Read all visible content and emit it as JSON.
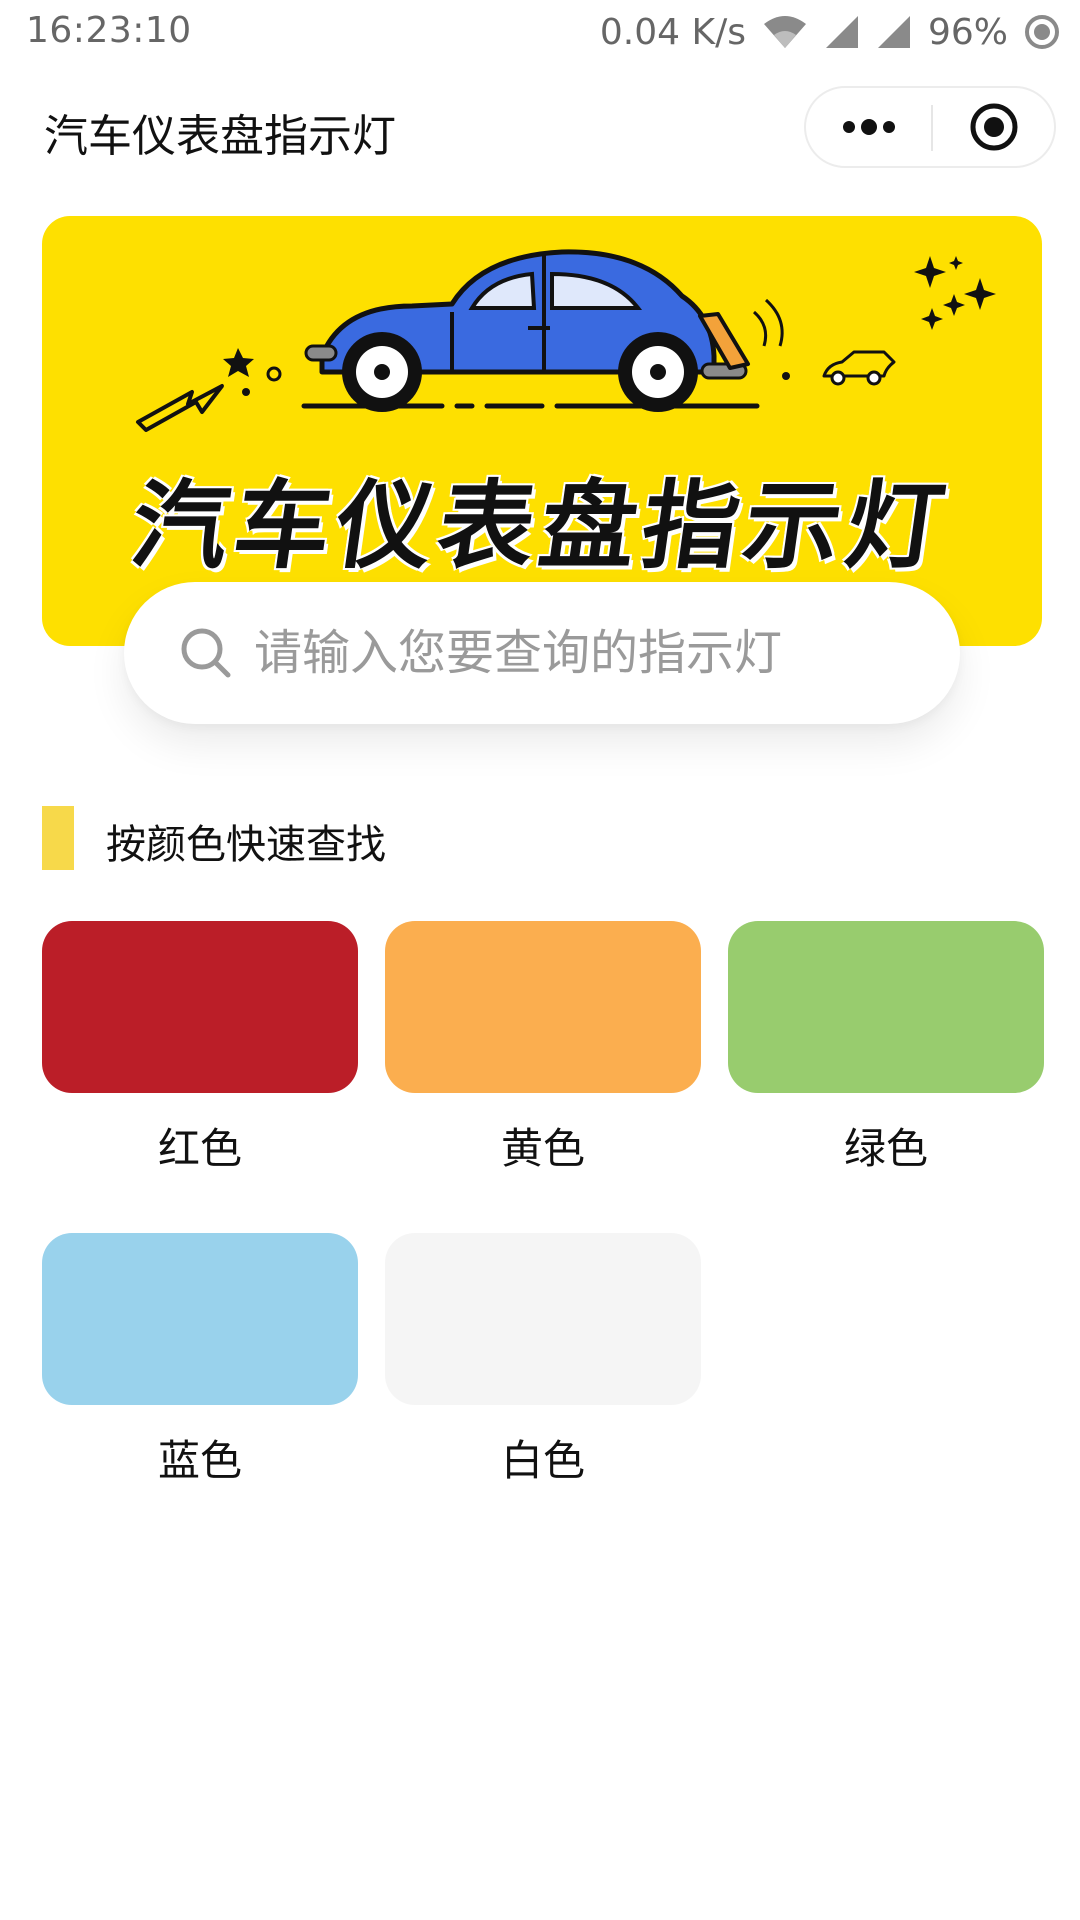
{
  "status_bar": {
    "time": "16:23:10",
    "speed": "0.04 K/s",
    "battery": "96%"
  },
  "nav": {
    "title": "汽车仪表盘指示灯",
    "more_icon": "more-dots-icon",
    "target_icon": "record-target-icon"
  },
  "banner": {
    "title": "汽车仪表盘指示灯",
    "background": "#fee000",
    "car_color": "#3a6ae0"
  },
  "search": {
    "placeholder": "请输入您要查询的指示灯",
    "value": ""
  },
  "section": {
    "title": "按颜色快速查找",
    "accent": "#f7d94a"
  },
  "colors": [
    {
      "label": "红色",
      "color": "#bb1e28"
    },
    {
      "label": "黄色",
      "color": "#fbae4f"
    },
    {
      "label": "绿色",
      "color": "#98cc6e"
    },
    {
      "label": "蓝色",
      "color": "#99d2ec"
    },
    {
      "label": "白色",
      "color": "#f5f5f5"
    }
  ]
}
